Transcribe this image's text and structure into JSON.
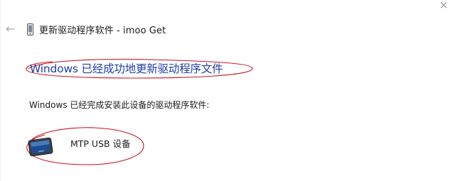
{
  "window": {
    "title": "更新驱动程序软件 - imoo Get",
    "close_glyph": "×",
    "back_glyph": "←"
  },
  "main": {
    "headline": "Windows 已经成功地更新驱动程序文件",
    "subtext": "Windows 已经完成安装此设备的驱动程序软件:",
    "device_name": "MTP USB 设备"
  },
  "icons": {
    "back": "back-arrow-icon",
    "small_device": "phone-device-icon",
    "large_device": "tablet-device-icon",
    "close": "close-icon"
  },
  "colors": {
    "headline": "#1f3fa8",
    "annotation": "#c8141e"
  }
}
